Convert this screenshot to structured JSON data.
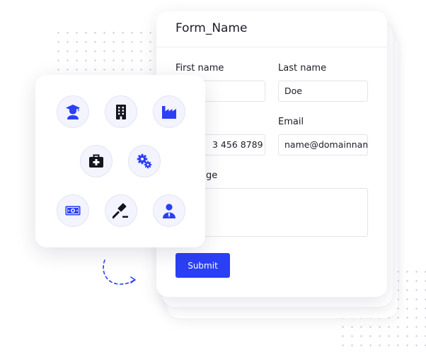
{
  "form": {
    "title": "Form_Name",
    "first_name_label": "First name",
    "first_name_value": "",
    "last_name_label": "Last name",
    "last_name_value": "Doe",
    "phone_value": "3 456 8789",
    "email_label": "Email",
    "email_value": "name@domainnam",
    "message_label_visible": "ge",
    "submit_label": "Submit"
  },
  "icons": [
    {
      "name": "graduate-icon"
    },
    {
      "name": "building-icon"
    },
    {
      "name": "factory-icon"
    },
    {
      "name": "medical-kit-icon"
    },
    {
      "name": "gears-icon"
    },
    {
      "name": "money-icon"
    },
    {
      "name": "gavel-icon"
    },
    {
      "name": "business-person-icon"
    }
  ],
  "colors": {
    "accent": "#2b3ff5",
    "icon_primary": "#2b3ff5",
    "icon_dark": "#14161f",
    "icon_bg": "#f3f4fd"
  }
}
